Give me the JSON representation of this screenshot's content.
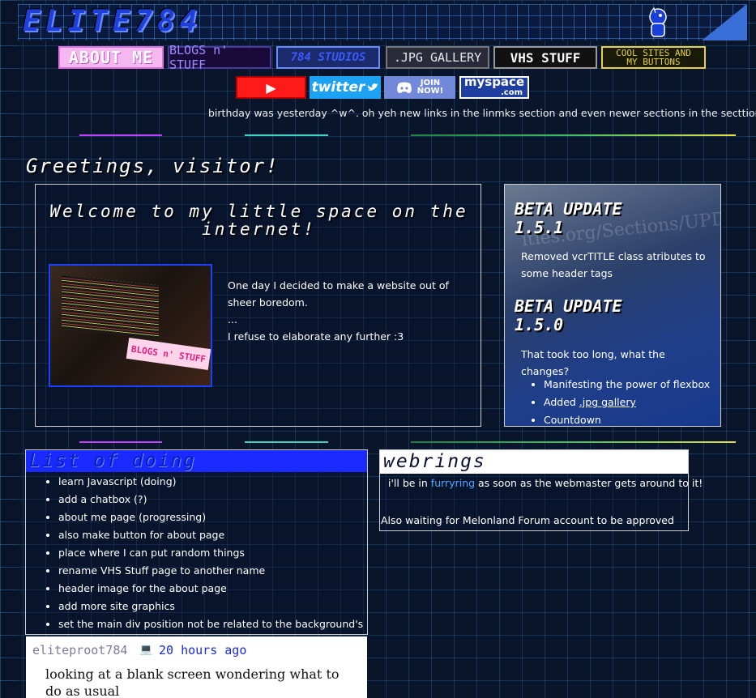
{
  "header": {
    "logo_text": "ELITE784"
  },
  "nav": {
    "about": "ABOUT ME",
    "blogs": "BLOGS n' STUFF",
    "studios": "784 STUDIOS",
    "jpg": ".JPG GALLERY",
    "vhs": "VHS STUFF",
    "cool": "COOL SITES AND\nMY BUTTONS"
  },
  "social": {
    "youtube": "▶",
    "twitter": "twitter",
    "discord_line1": "JOIN",
    "discord_line2": "NOW!",
    "myspace": "myspace",
    "myspace_suffix": ".com"
  },
  "ticker": "birthday was yesterday ^w^. oh yeh new links in the linmks section and even newer sections in the secttions se",
  "greeting": "Greetings, visitor!",
  "welcome": {
    "title": "Welcome to my little space on the internet!",
    "photo_sticker": "BLOGS n' STUFF",
    "para1": "One day I decided to make a website out of sheer boredom.",
    "para2": "...",
    "para3": "I refuse to elaborate any further :3"
  },
  "updates": {
    "bg_text": "ities.org/Sections/UPDATES",
    "title1": "BETA UPDATE 1.5.1",
    "text1": "Removed vcrTITLE class atributes to some header tags",
    "title2": "BETA UPDATE 1.5.0",
    "text2": "That took too long, what the changes?",
    "item1": "Manifesting the power of flexbox",
    "item2_prefix": "Added ",
    "item2_link": ".jpg gallery",
    "item3": "Countdown"
  },
  "doing": {
    "title": "List of doing",
    "items": [
      "learn Javascript (doing)",
      "add a chatbox (?)",
      "about me page (progressing)",
      "also make button for about page",
      "place where I can put random things",
      "rename VHS Stuff page to another name",
      "header image for the about page",
      "add more site graphics",
      "set the main div position not be related to the background's"
    ]
  },
  "webrings": {
    "title": "webrings",
    "line1_prefix": "i'll be in ",
    "line1_link": "furryring",
    "line1_suffix": " as soon as the webmaster gets around to it!",
    "line2": "Also waiting for Melonland Forum account to be approved"
  },
  "status": {
    "user": "eliteproot784",
    "icon": "💻",
    "time": "20 hours ago",
    "body": "looking at a blank screen wondering what to do as usual"
  },
  "colors": {
    "accent_blue": "#1a2aff",
    "pink": "#f5b7f0",
    "divider_colors": [
      "#c040ff",
      "#40d0c0",
      "#40c060",
      "#e8e040"
    ]
  }
}
